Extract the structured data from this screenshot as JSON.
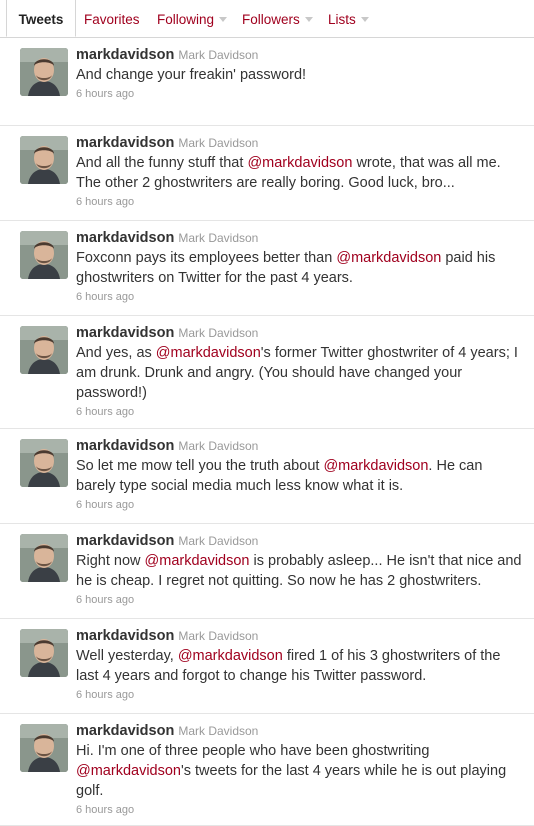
{
  "tabs": {
    "tweets": "Tweets",
    "favorites": "Favorites",
    "following": "Following",
    "followers": "Followers",
    "lists": "Lists"
  },
  "colors": {
    "link": "#a0001e",
    "text": "#333333",
    "muted": "#999999"
  },
  "tweets": [
    {
      "screen_name": "markdavidson",
      "full_name": "Mark Davidson",
      "time": "6 hours ago",
      "parts": [
        {
          "t": "And change your freakin' password!"
        }
      ]
    },
    {
      "screen_name": "markdavidson",
      "full_name": "Mark Davidson",
      "time": "6 hours ago",
      "parts": [
        {
          "t": "And all the funny stuff that "
        },
        {
          "m": "@markdavidson"
        },
        {
          "t": " wrote, that was all me. The other 2 ghostwriters are really boring. Good luck, bro..."
        }
      ]
    },
    {
      "screen_name": "markdavidson",
      "full_name": "Mark Davidson",
      "time": "6 hours ago",
      "parts": [
        {
          "t": "Foxconn pays its employees better than "
        },
        {
          "m": "@markdavidson"
        },
        {
          "t": " paid his ghostwriters on Twitter for the past 4 years."
        }
      ]
    },
    {
      "screen_name": "markdavidson",
      "full_name": "Mark Davidson",
      "time": "6 hours ago",
      "parts": [
        {
          "t": "And yes, as "
        },
        {
          "m": "@markdavidson"
        },
        {
          "t": "'s former Twitter ghostwriter of 4 years; I am drunk. Drunk and angry. (You should have changed your password!)"
        }
      ]
    },
    {
      "screen_name": "markdavidson",
      "full_name": "Mark Davidson",
      "time": "6 hours ago",
      "parts": [
        {
          "t": "So let me mow tell you the truth about "
        },
        {
          "m": "@markdavidson"
        },
        {
          "t": ". He can barely type social media much less know what it is."
        }
      ]
    },
    {
      "screen_name": "markdavidson",
      "full_name": "Mark Davidson",
      "time": "6 hours ago",
      "parts": [
        {
          "t": "Right now "
        },
        {
          "m": "@markdavidson"
        },
        {
          "t": " is probably asleep... He isn't that nice and he is cheap. I regret not quitting. So now he has 2 ghostwriters."
        }
      ]
    },
    {
      "screen_name": "markdavidson",
      "full_name": "Mark Davidson",
      "time": "6 hours ago",
      "parts": [
        {
          "t": "Well yesterday, "
        },
        {
          "m": "@markdavidson"
        },
        {
          "t": " fired 1 of his 3 ghostwriters of the last 4 years and forgot to change his Twitter password."
        }
      ]
    },
    {
      "screen_name": "markdavidson",
      "full_name": "Mark Davidson",
      "time": "6 hours ago",
      "parts": [
        {
          "t": "Hi. I'm one of three people who have been ghostwriting "
        },
        {
          "m": "@markdavidson"
        },
        {
          "t": "'s tweets for the last 4 years while he is out playing golf."
        }
      ]
    }
  ]
}
